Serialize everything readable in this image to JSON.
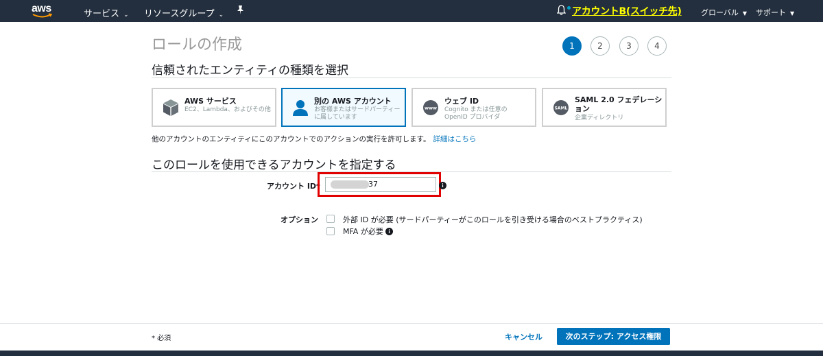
{
  "topnav": {
    "logo": "aws",
    "services": "サービス",
    "resource_groups": "リソースグループ",
    "pin_icon": "pin-icon",
    "bell_icon": "bell-icon",
    "account": "アカウントB(スイッチ先)",
    "region": "グローバル",
    "support": "サポート"
  },
  "page": {
    "title": "ロールの作成",
    "steps": [
      "1",
      "2",
      "3",
      "4"
    ],
    "active_step": "1"
  },
  "entity_section": {
    "title": "信頼されたエンティティの種類を選択",
    "cards": [
      {
        "title": "AWS サービス",
        "desc": "EC2、Lambda、およびその他",
        "icon": "cube-icon",
        "selected": false
      },
      {
        "title": "別の AWS アカウント",
        "desc": "お客様またはサードパーティーに属しています",
        "icon": "user-icon",
        "selected": true
      },
      {
        "title": "ウェブ ID",
        "desc": "Cognito または任意の OpenID プロバイダ",
        "icon": "www-icon",
        "selected": false
      },
      {
        "title": "SAML 2.0 フェデレーション",
        "desc": "企業ディレクトリ",
        "icon": "saml-icon",
        "selected": false
      }
    ],
    "help_text": "他のアカウントのエンティティにこのアカウントでのアクションの実行を許可します。",
    "help_link": "詳細はこちら"
  },
  "account_section": {
    "title": "このロールを使用できるアカウントを指定する",
    "account_id_label": "アカウント ID*",
    "account_id_value": "37",
    "options_label": "オプション",
    "options": [
      {
        "label": "外部 ID が必要 (サードパーティーがこのロールを引き受ける場合のベストプラクティス)",
        "checked": false
      },
      {
        "label": "MFA が必要",
        "checked": false
      }
    ]
  },
  "footer": {
    "required_note": "* 必須",
    "cancel": "キャンセル",
    "next": "次のステップ: アクセス権限"
  }
}
